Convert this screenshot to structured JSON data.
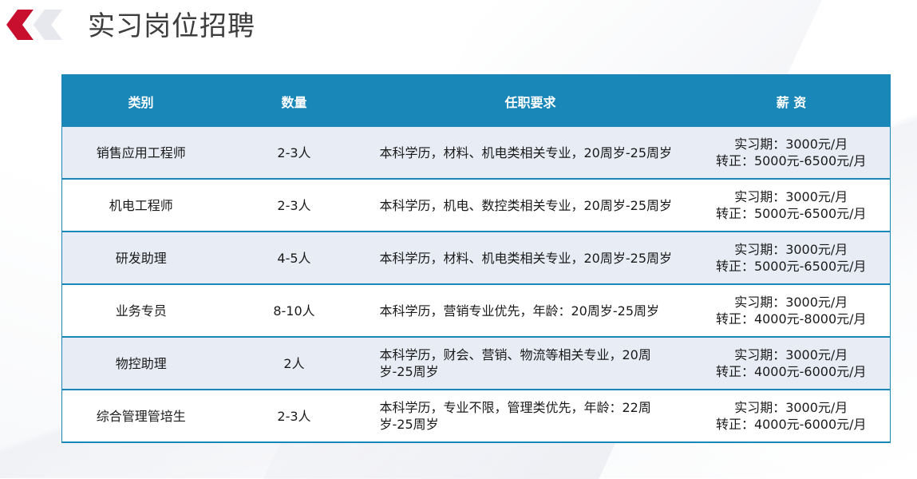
{
  "page": {
    "title": "实习岗位招聘"
  },
  "colors": {
    "header_bg": "#1a87b9",
    "odd_row_bg": "#e8ecf4",
    "even_row_bg": "#ffffff",
    "logo_red": "#c8102e",
    "logo_grey": "#cfd3da"
  },
  "icons": {
    "logo": "red-chevron-logo"
  },
  "table": {
    "headers": [
      "类别",
      "数量",
      "任职要求",
      "薪 资"
    ],
    "rows": [
      {
        "category": "销售应用工程师",
        "count": "2-3人",
        "requirement": "本科学历，材料、机电类相关专业，20周岁-25周岁",
        "salary_intern": "实习期：3000元/月",
        "salary_regular": "转正：5000元-6500元/月"
      },
      {
        "category": "机电工程师",
        "count": "2-3人",
        "requirement": "本科学历，机电、数控类相关专业，20周岁-25周岁",
        "salary_intern": "实习期：3000元/月",
        "salary_regular": "转正：5000元-6500元/月"
      },
      {
        "category": "研发助理",
        "count": "4-5人",
        "requirement": "本科学历，材料、机电类相关专业，20周岁-25周岁",
        "salary_intern": "实习期：3000元/月",
        "salary_regular": "转正：5000元-6500元/月"
      },
      {
        "category": "业务专员",
        "count": "8-10人",
        "requirement": "本科学历，营销专业优先，年龄：20周岁-25周岁",
        "salary_intern": "实习期：3000元/月",
        "salary_regular": "转正：4000元-8000元/月"
      },
      {
        "category": "物控助理",
        "count": "2人",
        "requirement": "本科学历，财会、营销、物流等相关专业，20周岁-25周岁",
        "salary_intern": "实习期：3000元/月",
        "salary_regular": "转正：4000元-6000元/月"
      },
      {
        "category": "综合管理管培生",
        "count": "2-3人",
        "requirement": "本科学历，专业不限，管理类优先，年龄：22周岁-25周岁",
        "salary_intern": "实习期：3000元/月",
        "salary_regular": "转正：4000元-6000元/月"
      }
    ]
  }
}
